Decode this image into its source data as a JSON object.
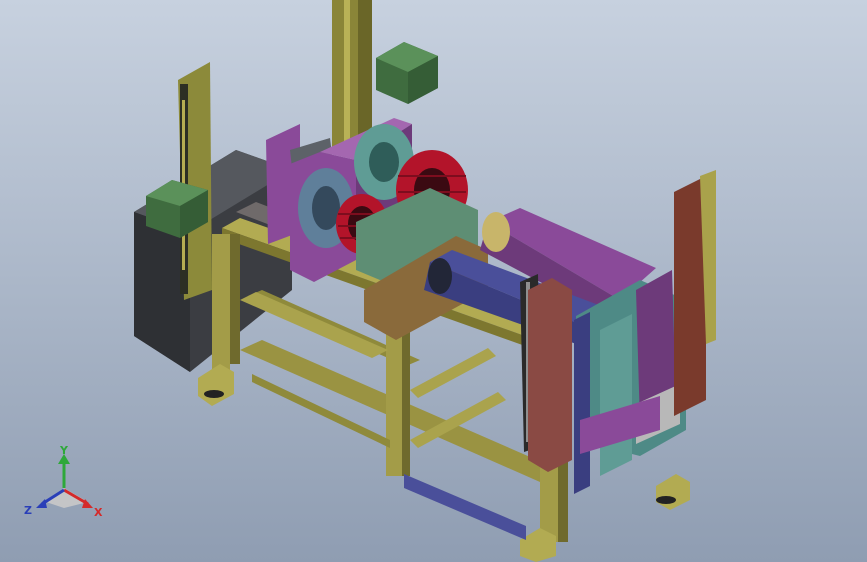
{
  "viewport": {
    "background_top": "#c7d1df",
    "background_bottom": "#8f9db2"
  },
  "model_colors": {
    "frame": "#a9a24b",
    "frame_dark": "#6e6a2c",
    "cabinet": "#3d3f44",
    "enclosure": "#4b7a4a",
    "drum_red": "#b3142a",
    "plate_purple": "#8a4a99",
    "plate_teal": "#4e8a86",
    "roller_blue": "#4a4f9a",
    "wood": "#8a6a3b",
    "panel_brown": "#7a3a2c"
  },
  "triad": {
    "icon": "coordinate-triad-icon",
    "x_label": "X",
    "y_label": "Y",
    "z_label": "Z",
    "x_color": "#d42a2a",
    "y_color": "#2ea83a",
    "z_color": "#2a3fb8"
  }
}
